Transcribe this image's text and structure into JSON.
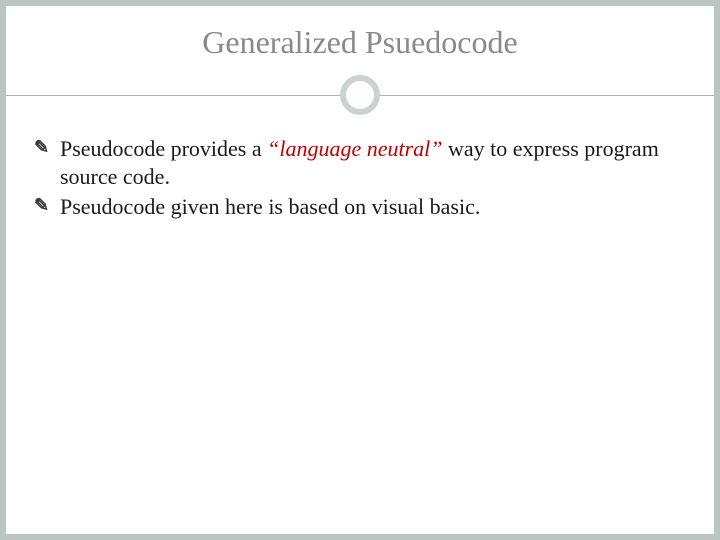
{
  "slide": {
    "title": "Generalized Psuedocode",
    "bullets": [
      {
        "pre": "Pseudocode provides a ",
        "emph": "“language neutral” ",
        "post": "way to express program source code."
      },
      {
        "pre": "Pseudocode given here is based on visual basic.",
        "emph": "",
        "post": ""
      }
    ],
    "bullet_glyph": ""
  }
}
